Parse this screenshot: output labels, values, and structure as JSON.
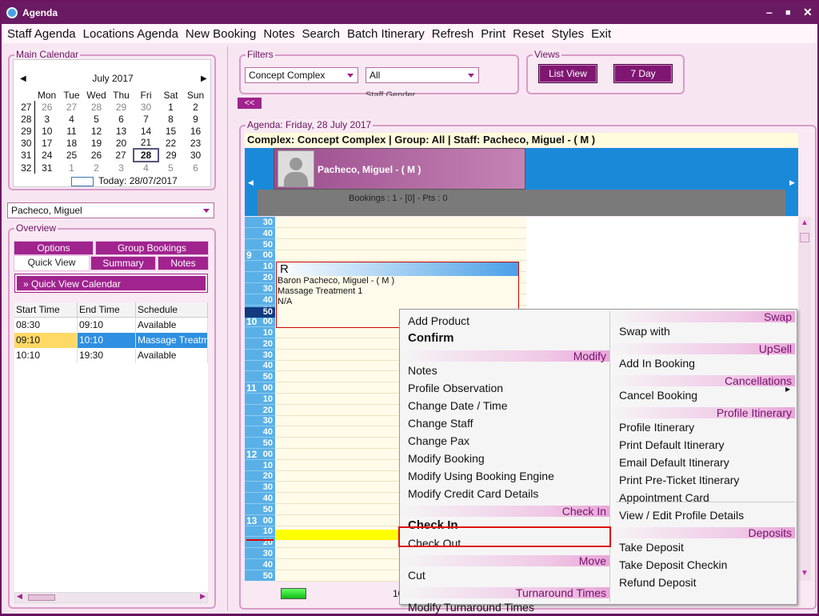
{
  "window": {
    "title": "Agenda"
  },
  "menu": [
    "Staff Agenda",
    "Locations Agenda",
    "New Booking",
    "Notes",
    "Search",
    "Batch Itinerary",
    "Refresh",
    "Print",
    "Reset",
    "Styles",
    "Exit"
  ],
  "main_calendar": {
    "title": "Main Calendar",
    "month": "July 2017",
    "weekdays": [
      "Mon",
      "Tue",
      "Wed",
      "Thu",
      "Fri",
      "Sat",
      "Sun"
    ],
    "weeks": [
      {
        "wk": "27",
        "days": [
          "26",
          "27",
          "28",
          "29",
          "30",
          "1",
          "2"
        ]
      },
      {
        "wk": "28",
        "days": [
          "3",
          "4",
          "5",
          "6",
          "7",
          "8",
          "9"
        ]
      },
      {
        "wk": "29",
        "days": [
          "10",
          "11",
          "12",
          "13",
          "14",
          "15",
          "16"
        ]
      },
      {
        "wk": "30",
        "days": [
          "17",
          "18",
          "19",
          "20",
          "21",
          "22",
          "23"
        ]
      },
      {
        "wk": "31",
        "days": [
          "24",
          "25",
          "26",
          "27",
          "28",
          "29",
          "30"
        ]
      },
      {
        "wk": "32",
        "days": [
          "31",
          "1",
          "2",
          "3",
          "4",
          "5",
          "6"
        ]
      }
    ],
    "today_label": "Today: 28/07/2017"
  },
  "staff_select": {
    "value": "Pacheco, Miguel"
  },
  "overview": {
    "title": "Overview",
    "tabs_top": [
      "Options",
      "Group Bookings"
    ],
    "tabs_bottom": [
      "Quick View",
      "Summary",
      "Notes"
    ],
    "quick_view_calendar": "Quick View Calendar",
    "columns": [
      "Start Time",
      "End Time",
      "Schedule"
    ],
    "rows": [
      [
        "08:30",
        "09:10",
        "Available"
      ],
      [
        "09:10",
        "10:10",
        "Massage Treatm"
      ],
      [
        "10:10",
        "19:30",
        "Available"
      ]
    ]
  },
  "filters": {
    "title": "Filters",
    "complex": "Concept Complex",
    "group": "All",
    "partial_label": "Staff Gender"
  },
  "views": {
    "title": "Views",
    "list_view": "List View",
    "seven_day": "7 Day"
  },
  "collapse_btn": "<<",
  "agenda": {
    "title": "Agenda: Friday, 28 July 2017",
    "header": "Complex: Concept Complex | Group: All | Staff: Pacheco, Miguel  - ( M )",
    "staff_name": "Pacheco, Miguel - ( M )",
    "bookings": "Bookings : 1 - [0] - Pts : 0",
    "booking": {
      "flag": "R",
      "line1": "Baron  Pacheco, Miguel - ( M )",
      "line2": "Massage Treatment 1",
      "line3": "N/A"
    },
    "bottom_partial": "10"
  },
  "context_menu": {
    "col1": [
      {
        "t": "item",
        "label": "Add Product"
      },
      {
        "t": "bold",
        "label": "Confirm"
      },
      {
        "t": "sec",
        "label": "Modify"
      },
      {
        "t": "item",
        "label": "Notes"
      },
      {
        "t": "item",
        "label": "Profile Observation"
      },
      {
        "t": "item",
        "label": "Change Date / Time"
      },
      {
        "t": "item",
        "label": "Change Staff"
      },
      {
        "t": "item",
        "label": "Change Pax"
      },
      {
        "t": "item",
        "label": "Modify Booking"
      },
      {
        "t": "item",
        "label": "Modify Using Booking Engine"
      },
      {
        "t": "item",
        "label": "Modify Credit Card Details"
      },
      {
        "t": "sec",
        "label": "Check In"
      },
      {
        "t": "bold",
        "label": "Check In"
      },
      {
        "t": "item",
        "label": "Check Out"
      },
      {
        "t": "sec",
        "label": "Move"
      },
      {
        "t": "item",
        "label": "Cut"
      },
      {
        "t": "sec",
        "label": "Turnaround Times"
      },
      {
        "t": "item",
        "label": "Modify Turnaround Times"
      }
    ],
    "col2": [
      {
        "t": "sec",
        "label": "Swap"
      },
      {
        "t": "item",
        "label": "Swap with"
      },
      {
        "t": "sec",
        "label": "UpSell"
      },
      {
        "t": "item",
        "label": "Add In Booking"
      },
      {
        "t": "sec",
        "label": "Cancellations"
      },
      {
        "t": "item",
        "label": "Cancel Booking"
      },
      {
        "t": "sec",
        "label": "Profile Itinerary"
      },
      {
        "t": "item",
        "label": "Profile Itinerary"
      },
      {
        "t": "item",
        "label": "Print Default Itinerary"
      },
      {
        "t": "item",
        "label": "Email Default Itinerary"
      },
      {
        "t": "item",
        "label": "Print Pre-Ticket Itinerary"
      },
      {
        "t": "item",
        "label": "Appointment Card"
      },
      {
        "t": "item",
        "label": "View / Edit Profile Details"
      },
      {
        "t": "sec",
        "label": "Deposits"
      },
      {
        "t": "item",
        "label": "Take Deposit"
      },
      {
        "t": "item",
        "label": "Take Deposit  Checkin"
      },
      {
        "t": "item",
        "label": "Refund Deposit"
      }
    ]
  },
  "time_slots": [
    "30",
    "40",
    "50",
    "9|00",
    "10",
    "20",
    "30",
    "40",
    "50",
    "10|00",
    "10",
    "20",
    "30",
    "40",
    "50",
    "11|00",
    "10",
    "20",
    "30",
    "40",
    "50",
    "12|00",
    "10",
    "20",
    "30",
    "40",
    "50",
    "13|00",
    "10",
    "20",
    "30",
    "40",
    "50"
  ],
  "colors": {
    "accent": "#a0238e",
    "title_bar": "#6a1a62",
    "time_col": "#5ab0e6",
    "highlight": "#ffff00",
    "selected_row": "#2f8fe0"
  }
}
